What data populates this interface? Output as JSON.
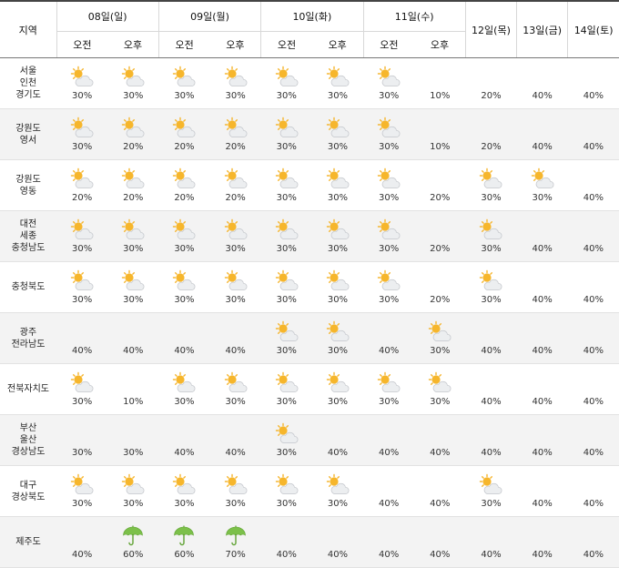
{
  "header": {
    "region_label": "지역",
    "days": [
      {
        "label": "08일(일)",
        "split": true
      },
      {
        "label": "09일(월)",
        "split": true
      },
      {
        "label": "10일(화)",
        "split": true
      },
      {
        "label": "11일(수)",
        "split": true
      },
      {
        "label": "12일(목)",
        "split": false
      },
      {
        "label": "13일(금)",
        "split": false
      },
      {
        "label": "14일(토)",
        "split": false
      }
    ],
    "am_label": "오전",
    "pm_label": "오후"
  },
  "icons": {
    "partly": "partly-cloudy-icon",
    "sunny": "sunny-icon",
    "cloudy": "cloudy-icon",
    "rain": "rain-umbrella-icon"
  },
  "colors": {
    "sun": "#f5b52e",
    "cloud": "#b9bcc2",
    "umbrella": "#7cc04a"
  },
  "rows": [
    {
      "region": "서울\n인천\n경기도",
      "cells": [
        [
          "partly",
          "30%"
        ],
        [
          "partly",
          "30%"
        ],
        [
          "partly",
          "30%"
        ],
        [
          "partly",
          "30%"
        ],
        [
          "partly",
          "30%"
        ],
        [
          "partly",
          "30%"
        ],
        [
          "partly",
          "30%"
        ],
        [
          "sunny",
          "10%"
        ],
        [
          "sunny",
          "20%"
        ],
        [
          "cloudy",
          "40%"
        ],
        [
          "cloudy",
          "40%"
        ]
      ]
    },
    {
      "region": "강원도\n영서",
      "cells": [
        [
          "partly",
          "30%"
        ],
        [
          "partly",
          "20%"
        ],
        [
          "partly",
          "20%"
        ],
        [
          "partly",
          "20%"
        ],
        [
          "partly",
          "30%"
        ],
        [
          "partly",
          "30%"
        ],
        [
          "partly",
          "30%"
        ],
        [
          "sunny",
          "10%"
        ],
        [
          "sunny",
          "20%"
        ],
        [
          "cloudy",
          "40%"
        ],
        [
          "cloudy",
          "40%"
        ]
      ]
    },
    {
      "region": "강원도\n영동",
      "cells": [
        [
          "partly",
          "20%"
        ],
        [
          "partly",
          "20%"
        ],
        [
          "partly",
          "20%"
        ],
        [
          "partly",
          "20%"
        ],
        [
          "partly",
          "30%"
        ],
        [
          "partly",
          "30%"
        ],
        [
          "partly",
          "30%"
        ],
        [
          "sunny",
          "20%"
        ],
        [
          "partly",
          "30%"
        ],
        [
          "partly",
          "30%"
        ],
        [
          "cloudy",
          "40%"
        ]
      ]
    },
    {
      "region": "대전\n세종\n충청남도",
      "cells": [
        [
          "partly",
          "30%"
        ],
        [
          "partly",
          "30%"
        ],
        [
          "partly",
          "30%"
        ],
        [
          "partly",
          "30%"
        ],
        [
          "partly",
          "30%"
        ],
        [
          "partly",
          "30%"
        ],
        [
          "partly",
          "30%"
        ],
        [
          "sunny",
          "20%"
        ],
        [
          "partly",
          "30%"
        ],
        [
          "cloudy",
          "40%"
        ],
        [
          "cloudy",
          "40%"
        ]
      ]
    },
    {
      "region": "충청북도",
      "cells": [
        [
          "partly",
          "30%"
        ],
        [
          "partly",
          "30%"
        ],
        [
          "partly",
          "30%"
        ],
        [
          "partly",
          "30%"
        ],
        [
          "partly",
          "30%"
        ],
        [
          "partly",
          "30%"
        ],
        [
          "partly",
          "30%"
        ],
        [
          "sunny",
          "20%"
        ],
        [
          "partly",
          "30%"
        ],
        [
          "cloudy",
          "40%"
        ],
        [
          "cloudy",
          "40%"
        ]
      ]
    },
    {
      "region": "광주\n전라남도",
      "cells": [
        [
          "cloudy",
          "40%"
        ],
        [
          "cloudy",
          "40%"
        ],
        [
          "cloudy",
          "40%"
        ],
        [
          "cloudy",
          "40%"
        ],
        [
          "partly",
          "30%"
        ],
        [
          "partly",
          "30%"
        ],
        [
          "cloudy",
          "40%"
        ],
        [
          "partly",
          "30%"
        ],
        [
          "cloudy",
          "40%"
        ],
        [
          "cloudy",
          "40%"
        ],
        [
          "cloudy",
          "40%"
        ]
      ]
    },
    {
      "region": "전북자치도",
      "cells": [
        [
          "partly",
          "30%"
        ],
        [
          "sunny",
          "10%"
        ],
        [
          "partly",
          "30%"
        ],
        [
          "partly",
          "30%"
        ],
        [
          "partly",
          "30%"
        ],
        [
          "partly",
          "30%"
        ],
        [
          "partly",
          "30%"
        ],
        [
          "partly",
          "30%"
        ],
        [
          "cloudy",
          "40%"
        ],
        [
          "cloudy",
          "40%"
        ],
        [
          "cloudy",
          "40%"
        ]
      ]
    },
    {
      "region": "부산\n울산\n경상남도",
      "cells": [
        [
          "cloudy",
          "30%"
        ],
        [
          "cloudy",
          "30%"
        ],
        [
          "cloudy",
          "40%"
        ],
        [
          "cloudy",
          "40%"
        ],
        [
          "partly",
          "30%"
        ],
        [
          "cloudy",
          "40%"
        ],
        [
          "cloudy",
          "40%"
        ],
        [
          "cloudy",
          "40%"
        ],
        [
          "cloudy",
          "40%"
        ],
        [
          "cloudy",
          "40%"
        ],
        [
          "cloudy",
          "40%"
        ]
      ]
    },
    {
      "region": "대구\n경상북도",
      "cells": [
        [
          "partly",
          "30%"
        ],
        [
          "partly",
          "30%"
        ],
        [
          "partly",
          "30%"
        ],
        [
          "partly",
          "30%"
        ],
        [
          "partly",
          "30%"
        ],
        [
          "partly",
          "30%"
        ],
        [
          "cloudy",
          "40%"
        ],
        [
          "cloudy",
          "40%"
        ],
        [
          "partly",
          "30%"
        ],
        [
          "cloudy",
          "40%"
        ],
        [
          "cloudy",
          "40%"
        ]
      ]
    },
    {
      "region": "제주도",
      "cells": [
        [
          "cloudy",
          "40%"
        ],
        [
          "rain",
          "60%"
        ],
        [
          "rain",
          "60%"
        ],
        [
          "rain",
          "70%"
        ],
        [
          "cloudy",
          "40%"
        ],
        [
          "cloudy",
          "40%"
        ],
        [
          "cloudy",
          "40%"
        ],
        [
          "cloudy",
          "40%"
        ],
        [
          "cloudy",
          "40%"
        ],
        [
          "cloudy",
          "40%"
        ],
        [
          "cloudy",
          "40%"
        ]
      ]
    }
  ]
}
